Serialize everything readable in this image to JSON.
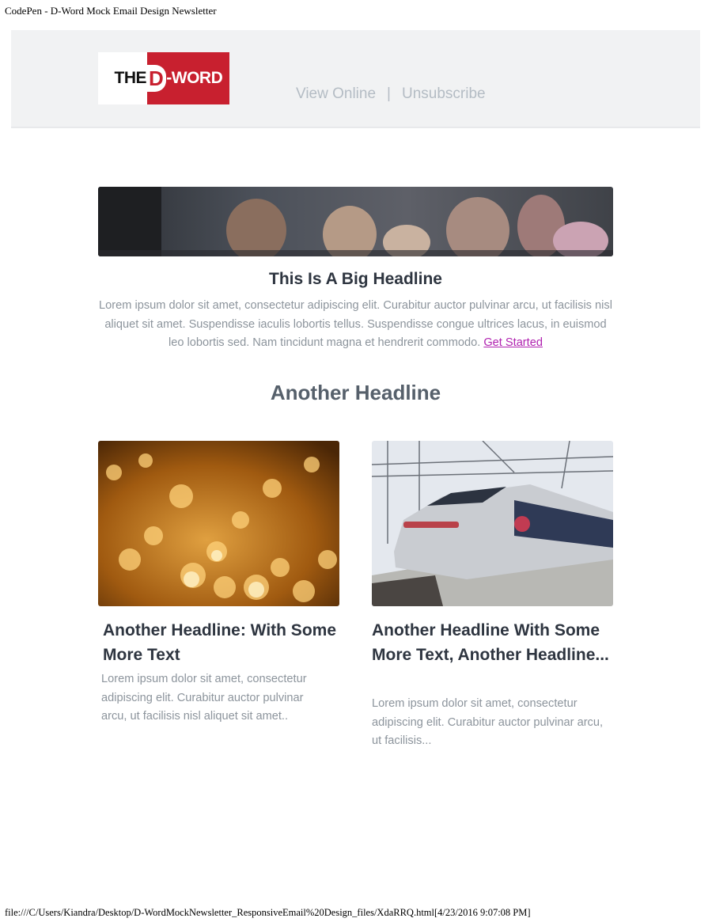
{
  "print": {
    "header": "CodePen - D-Word Mock Email Design Newsletter",
    "footer": "file:///C/Users/Kiandra/Desktop/D-WordMockNewsletter_ResponsiveEmail%20Design_files/XdaRRQ.html[4/23/2016 9:07:08 PM]"
  },
  "header": {
    "logo_text": "THE D-WORD",
    "view_online": "View Online",
    "separator": "|",
    "unsubscribe": "Unsubscribe"
  },
  "hero": {
    "headline": "This Is A Big Headline",
    "body": "Lorem ipsum dolor sit amet, consectetur adipiscing elit. Curabitur auctor pulvinar arcu, ut facilisis nisl aliquet sit amet. Suspendisse iaculis lobortis tellus. Suspendisse congue ultrices lacus, in euismod leo lobortis sed. Nam tincidunt magna et hendrerit commodo.",
    "cta": "Get Started"
  },
  "section": {
    "headline": "Another Headline"
  },
  "cards": [
    {
      "title": "Another Headline: With Some More Text",
      "body": "Lorem ipsum dolor sit amet, consectetur adipiscing elit. Curabitur auctor pulvinar arcu, ut facilisis nisl aliquet sit amet.."
    },
    {
      "title": "Another Headline With Some More Text, Another Headline...",
      "body": "Lorem ipsum dolor sit amet, consectetur adipiscing elit. Curabitur auctor pulvinar arcu, ut facilisis..."
    }
  ],
  "colors": {
    "brand_red": "#c8202f",
    "link_purple": "#b022b0",
    "header_bg": "#f1f2f3"
  }
}
